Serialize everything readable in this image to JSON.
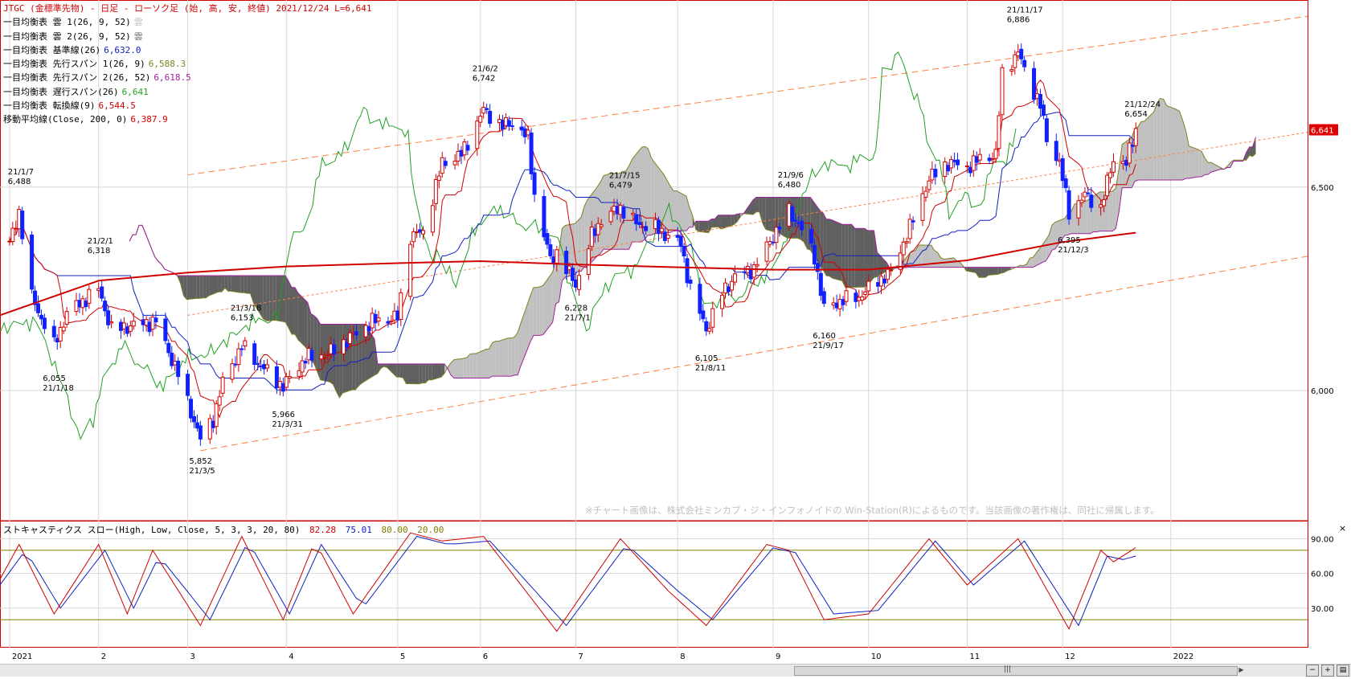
{
  "header": {
    "lines": [
      {
        "label": "JTGC (金標準先物) - 日足 - ローソク足 (始, 高, 安, 終値)  2021/12/24 L=6,641",
        "value": "",
        "color": "#d00000",
        "value_color": "#d00000"
      },
      {
        "label": "一目均衡表 雲 1(26, 9, 52)",
        "value": "雲",
        "color": "#000000",
        "value_color": "#c0c0c0"
      },
      {
        "label": "一目均衡表 雲 2(26, 9, 52)",
        "value": "雲",
        "color": "#000000",
        "value_color": "#707070"
      },
      {
        "label": "一目均衡表 基準線(26)",
        "value": "6,632.0",
        "color": "#000000",
        "value_color": "#1020c0"
      },
      {
        "label": "一目均衡表 先行スパン 1(26, 9)",
        "value": "6,588.3",
        "color": "#000000",
        "value_color": "#808020"
      },
      {
        "label": "一目均衡表 先行スパン 2(26, 52)",
        "value": "6,618.5",
        "color": "#000000",
        "value_color": "#a020a0"
      },
      {
        "label": "一目均衡表 遅行スパン(26)",
        "value": "6,641",
        "color": "#000000",
        "value_color": "#20a020"
      },
      {
        "label": "一目均衡表 転換線(9)",
        "value": "6,544.5",
        "color": "#000000",
        "value_color": "#d00000"
      },
      {
        "label": "移動平均線(Close, 200, 0)",
        "value": "6,387.9",
        "color": "#000000",
        "value_color": "#d00000"
      }
    ]
  },
  "watermark": "※チャート画像は、株式会社ミンカブ・ジ・インフォノイドの Win-Station(R)によるものです。当該画像の著作権は、同社に帰属します。",
  "stoch_legend": {
    "label": "ストキャスティクス スロー(High, Low, Close, 5, 3, 3, 20, 80)",
    "values": [
      {
        "text": "82.28",
        "color": "#d00000"
      },
      {
        "text": "75.01",
        "color": "#1020c0"
      },
      {
        "text": "80.00",
        "color": "#808000"
      },
      {
        "text": "20.00",
        "color": "#808000"
      }
    ]
  },
  "close_label": "×",
  "scroll_grip": "|||",
  "colors": {
    "up_candle": "#d00000",
    "down_candle": "#1020ff",
    "kijun": "#1020c0",
    "tenkan": "#d00000",
    "chikou": "#20a020",
    "ma200": "#d00000",
    "cloud_light": "#c0c0c0",
    "cloud_dark": "#606060",
    "span1": "#808020",
    "span2": "#a020a0",
    "channel": "#ff8040",
    "last_price_box": "#e00000",
    "stoch_k": "#d00000",
    "stoch_d": "#1020c0",
    "stoch_band": "#808000",
    "frame": "#d00000",
    "grid": "#d8d8d8"
  },
  "chart_data": [
    {
      "type": "line",
      "subtype": "candlestick with ichimoku cloud",
      "title": "JTGC (金標準先物) - 日足 - ローソク足 (始, 高, 安, 終値)",
      "date": "2021/12/24",
      "last_price": 6641,
      "last_price_label": "6,641",
      "xlabel": "",
      "ylabel": "",
      "ylim": [
        5680,
        6960
      ],
      "y_ticks": [
        6000,
        6500
      ],
      "y_tick_labels": [
        "6,000",
        "6,500"
      ],
      "x_axis": {
        "range": [
          "2021-01-01",
          "2022-02-16"
        ],
        "ticks": [
          {
            "date": "2021-01-04",
            "label": "2021"
          },
          {
            "date": "2021-02-01",
            "label": "2"
          },
          {
            "date": "2021-03-01",
            "label": "3"
          },
          {
            "date": "2021-04-01",
            "label": "4"
          },
          {
            "date": "2021-05-06",
            "label": "5"
          },
          {
            "date": "2021-06-01",
            "label": "6"
          },
          {
            "date": "2021-07-01",
            "label": "7"
          },
          {
            "date": "2021-08-02",
            "label": "8"
          },
          {
            "date": "2021-09-01",
            "label": "9"
          },
          {
            "date": "2021-10-01",
            "label": "10"
          },
          {
            "date": "2021-11-01",
            "label": "11"
          },
          {
            "date": "2021-12-01",
            "label": "12"
          },
          {
            "date": "2022-01-04",
            "label": "2022"
          }
        ]
      },
      "annotations": [
        {
          "date": "21/1/7",
          "price": "6,488",
          "x": "2021-01-07",
          "y": 6488,
          "pos": "above"
        },
        {
          "date": "21/1/18",
          "price": "6,055",
          "x": "2021-01-18",
          "y": 6055,
          "pos": "below"
        },
        {
          "date": "21/2/1",
          "price": "6,318",
          "x": "2021-02-01",
          "y": 6318,
          "pos": "above"
        },
        {
          "date": "21/3/5",
          "price": "5,852",
          "x": "2021-03-05",
          "y": 5852,
          "pos": "below"
        },
        {
          "date": "21/3/18",
          "price": "6,153",
          "x": "2021-03-18",
          "y": 6153,
          "pos": "above"
        },
        {
          "date": "21/3/31",
          "price": "5,966",
          "x": "2021-03-31",
          "y": 5966,
          "pos": "below"
        },
        {
          "date": "21/6/2",
          "price": "6,742",
          "x": "2021-06-02",
          "y": 6742,
          "pos": "above"
        },
        {
          "date": "21/7/1",
          "price": "6,228",
          "x": "2021-07-01",
          "y": 6228,
          "pos": "below"
        },
        {
          "date": "21/7/15",
          "price": "6,479",
          "x": "2021-07-15",
          "y": 6479,
          "pos": "above"
        },
        {
          "date": "21/8/11",
          "price": "6,105",
          "x": "2021-08-11",
          "y": 6105,
          "pos": "below"
        },
        {
          "date": "21/9/6",
          "price": "6,480",
          "x": "2021-09-06",
          "y": 6480,
          "pos": "above"
        },
        {
          "date": "21/9/17",
          "price": "6,160",
          "x": "2021-09-17",
          "y": 6160,
          "pos": "below"
        },
        {
          "date": "21/11/17",
          "price": "6,886",
          "x": "2021-11-17",
          "y": 6886,
          "pos": "above"
        },
        {
          "date": "21/12/3",
          "price": "6,395",
          "x": "2021-12-03",
          "y": 6395,
          "pos": "below"
        },
        {
          "date": "21/12/24",
          "price": "6,654",
          "x": "2021-12-24",
          "y": 6654,
          "pos": "above"
        }
      ],
      "candle_anchors": [
        {
          "date": "2021-01-04",
          "close": 6360
        },
        {
          "date": "2021-01-07",
          "close": 6440
        },
        {
          "date": "2021-01-11",
          "close": 6230
        },
        {
          "date": "2021-01-18",
          "close": 6110
        },
        {
          "date": "2021-01-22",
          "close": 6190
        },
        {
          "date": "2021-02-01",
          "close": 6250
        },
        {
          "date": "2021-02-05",
          "close": 6150
        },
        {
          "date": "2021-02-12",
          "close": 6160
        },
        {
          "date": "2021-02-19",
          "close": 6170
        },
        {
          "date": "2021-02-26",
          "close": 6040
        },
        {
          "date": "2021-03-05",
          "close": 5880
        },
        {
          "date": "2021-03-09",
          "close": 5930
        },
        {
          "date": "2021-03-12",
          "close": 6020
        },
        {
          "date": "2021-03-18",
          "close": 6110
        },
        {
          "date": "2021-03-24",
          "close": 6060
        },
        {
          "date": "2021-03-31",
          "close": 6010
        },
        {
          "date": "2021-04-07",
          "close": 6080
        },
        {
          "date": "2021-04-14",
          "close": 6090
        },
        {
          "date": "2021-04-21",
          "close": 6130
        },
        {
          "date": "2021-04-28",
          "close": 6170
        },
        {
          "date": "2021-05-06",
          "close": 6180
        },
        {
          "date": "2021-05-10",
          "close": 6380
        },
        {
          "date": "2021-05-14",
          "close": 6390
        },
        {
          "date": "2021-05-20",
          "close": 6560
        },
        {
          "date": "2021-05-26",
          "close": 6580
        },
        {
          "date": "2021-06-02",
          "close": 6690
        },
        {
          "date": "2021-06-08",
          "close": 6650
        },
        {
          "date": "2021-06-11",
          "close": 6660
        },
        {
          "date": "2021-06-16",
          "close": 6620
        },
        {
          "date": "2021-06-18",
          "close": 6480
        },
        {
          "date": "2021-06-23",
          "close": 6320
        },
        {
          "date": "2021-06-25",
          "close": 6340
        },
        {
          "date": "2021-07-01",
          "close": 6260
        },
        {
          "date": "2021-07-06",
          "close": 6380
        },
        {
          "date": "2021-07-09",
          "close": 6420
        },
        {
          "date": "2021-07-15",
          "close": 6450
        },
        {
          "date": "2021-07-20",
          "close": 6410
        },
        {
          "date": "2021-07-26",
          "close": 6400
        },
        {
          "date": "2021-07-30",
          "close": 6380
        },
        {
          "date": "2021-08-03",
          "close": 6360
        },
        {
          "date": "2021-08-06",
          "close": 6250
        },
        {
          "date": "2021-08-11",
          "close": 6150
        },
        {
          "date": "2021-08-16",
          "close": 6240
        },
        {
          "date": "2021-08-20",
          "close": 6280
        },
        {
          "date": "2021-08-26",
          "close": 6300
        },
        {
          "date": "2021-09-01",
          "close": 6380
        },
        {
          "date": "2021-09-06",
          "close": 6440
        },
        {
          "date": "2021-09-09",
          "close": 6410
        },
        {
          "date": "2021-09-14",
          "close": 6330
        },
        {
          "date": "2021-09-17",
          "close": 6200
        },
        {
          "date": "2021-09-22",
          "close": 6220
        },
        {
          "date": "2021-09-28",
          "close": 6230
        },
        {
          "date": "2021-10-04",
          "close": 6270
        },
        {
          "date": "2021-10-08",
          "close": 6290
        },
        {
          "date": "2021-10-14",
          "close": 6400
        },
        {
          "date": "2021-10-20",
          "close": 6520
        },
        {
          "date": "2021-10-26",
          "close": 6560
        },
        {
          "date": "2021-11-01",
          "close": 6550
        },
        {
          "date": "2021-11-05",
          "close": 6570
        },
        {
          "date": "2021-11-10",
          "close": 6580
        },
        {
          "date": "2021-11-12",
          "close": 6780
        },
        {
          "date": "2021-11-17",
          "close": 6830
        },
        {
          "date": "2021-11-19",
          "close": 6790
        },
        {
          "date": "2021-11-24",
          "close": 6700
        },
        {
          "date": "2021-11-26",
          "close": 6620
        },
        {
          "date": "2021-11-30",
          "close": 6560
        },
        {
          "date": "2021-12-03",
          "close": 6440
        },
        {
          "date": "2021-12-08",
          "close": 6480
        },
        {
          "date": "2021-12-13",
          "close": 6450
        },
        {
          "date": "2021-12-17",
          "close": 6570
        },
        {
          "date": "2021-12-21",
          "close": 6560
        },
        {
          "date": "2021-12-24",
          "close": 6641
        }
      ],
      "ma200_anchors": [
        {
          "date": "2021-01-01",
          "y": 6185
        },
        {
          "date": "2021-02-01",
          "y": 6270
        },
        {
          "date": "2021-03-01",
          "y": 6290
        },
        {
          "date": "2021-04-01",
          "y": 6305
        },
        {
          "date": "2021-05-06",
          "y": 6313
        },
        {
          "date": "2021-06-01",
          "y": 6318
        },
        {
          "date": "2021-07-01",
          "y": 6310
        },
        {
          "date": "2021-08-02",
          "y": 6303
        },
        {
          "date": "2021-09-01",
          "y": 6297
        },
        {
          "date": "2021-10-01",
          "y": 6297
        },
        {
          "date": "2021-11-01",
          "y": 6320
        },
        {
          "date": "2021-12-01",
          "y": 6365
        },
        {
          "date": "2021-12-24",
          "y": 6388
        }
      ],
      "channel_lines": [
        {
          "from": {
            "x": "2021-03-01",
            "y": 6530
          },
          "to": {
            "x": "2022-02-16",
            "y": 6920
          },
          "style": "dashed"
        },
        {
          "from": {
            "x": "2021-03-05",
            "y": 5852
          },
          "to": {
            "x": "2022-02-16",
            "y": 6330
          },
          "style": "dashed"
        },
        {
          "from": {
            "x": "2021-03-01",
            "y": 6185
          },
          "to": {
            "x": "2022-02-16",
            "y": 6635
          },
          "style": "dotted"
        }
      ]
    },
    {
      "type": "line",
      "title": "ストキャスティクス スロー(High, Low, Close, 5, 3, 3, 20, 80)",
      "ylim": [
        0,
        100
      ],
      "y_ticks": [
        30,
        60,
        90
      ],
      "y_tick_labels": [
        "30.00",
        "60.00",
        "90.00"
      ],
      "bands": [
        80,
        20
      ],
      "last_values": {
        "slow_k": 82.28,
        "slow_d": 75.01
      },
      "series_k_anchors": [
        {
          "date": "2021-01-01",
          "y": 55
        },
        {
          "date": "2021-01-07",
          "y": 85
        },
        {
          "date": "2021-01-18",
          "y": 25
        },
        {
          "date": "2021-02-01",
          "y": 85
        },
        {
          "date": "2021-02-10",
          "y": 25
        },
        {
          "date": "2021-02-18",
          "y": 80
        },
        {
          "date": "2021-03-05",
          "y": 15
        },
        {
          "date": "2021-03-18",
          "y": 92
        },
        {
          "date": "2021-03-31",
          "y": 20
        },
        {
          "date": "2021-04-10",
          "y": 88
        },
        {
          "date": "2021-04-22",
          "y": 25
        },
        {
          "date": "2021-05-10",
          "y": 95
        },
        {
          "date": "2021-05-20",
          "y": 88
        },
        {
          "date": "2021-06-02",
          "y": 92
        },
        {
          "date": "2021-06-25",
          "y": 10
        },
        {
          "date": "2021-07-15",
          "y": 90
        },
        {
          "date": "2021-07-30",
          "y": 45
        },
        {
          "date": "2021-08-11",
          "y": 15
        },
        {
          "date": "2021-08-30",
          "y": 85
        },
        {
          "date": "2021-09-06",
          "y": 80
        },
        {
          "date": "2021-09-17",
          "y": 20
        },
        {
          "date": "2021-10-01",
          "y": 25
        },
        {
          "date": "2021-10-20",
          "y": 90
        },
        {
          "date": "2021-11-01",
          "y": 50
        },
        {
          "date": "2021-11-17",
          "y": 90
        },
        {
          "date": "2021-12-03",
          "y": 12
        },
        {
          "date": "2021-12-13",
          "y": 80
        },
        {
          "date": "2021-12-17",
          "y": 70
        },
        {
          "date": "2021-12-24",
          "y": 82.28
        }
      ],
      "series_d_anchors": [
        {
          "date": "2021-01-01",
          "y": 50
        },
        {
          "date": "2021-01-09",
          "y": 80
        },
        {
          "date": "2021-01-20",
          "y": 30
        },
        {
          "date": "2021-02-03",
          "y": 80
        },
        {
          "date": "2021-02-12",
          "y": 30
        },
        {
          "date": "2021-02-20",
          "y": 75
        },
        {
          "date": "2021-03-08",
          "y": 20
        },
        {
          "date": "2021-03-20",
          "y": 88
        },
        {
          "date": "2021-04-02",
          "y": 25
        },
        {
          "date": "2021-04-12",
          "y": 85
        },
        {
          "date": "2021-04-25",
          "y": 30
        },
        {
          "date": "2021-05-12",
          "y": 92
        },
        {
          "date": "2021-05-22",
          "y": 85
        },
        {
          "date": "2021-06-04",
          "y": 88
        },
        {
          "date": "2021-06-28",
          "y": 15
        },
        {
          "date": "2021-07-17",
          "y": 85
        },
        {
          "date": "2021-08-02",
          "y": 45
        },
        {
          "date": "2021-08-13",
          "y": 20
        },
        {
          "date": "2021-09-01",
          "y": 82
        },
        {
          "date": "2021-09-08",
          "y": 78
        },
        {
          "date": "2021-09-20",
          "y": 25
        },
        {
          "date": "2021-10-04",
          "y": 28
        },
        {
          "date": "2021-10-22",
          "y": 88
        },
        {
          "date": "2021-11-03",
          "y": 50
        },
        {
          "date": "2021-11-19",
          "y": 88
        },
        {
          "date": "2021-12-06",
          "y": 15
        },
        {
          "date": "2021-12-15",
          "y": 75
        },
        {
          "date": "2021-12-20",
          "y": 72
        },
        {
          "date": "2021-12-24",
          "y": 75.01
        }
      ]
    }
  ]
}
